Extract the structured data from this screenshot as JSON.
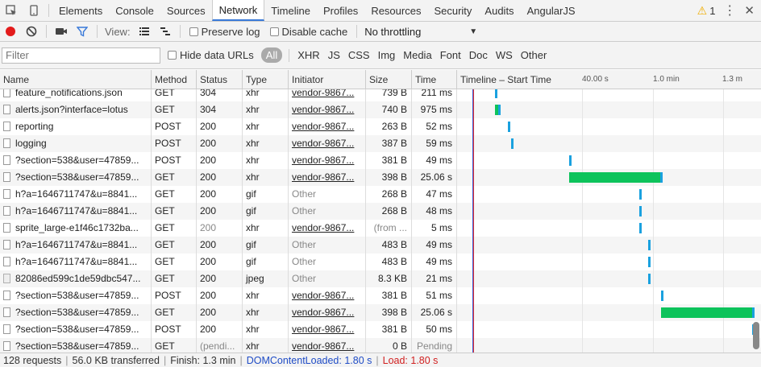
{
  "tabs": [
    "Elements",
    "Console",
    "Sources",
    "Network",
    "Timeline",
    "Profiles",
    "Resources",
    "Security",
    "Audits",
    "AngularJS"
  ],
  "active_tab": "Network",
  "warnings_count": "1",
  "toolbar": {
    "view_label": "View:",
    "preserve_log": "Preserve log",
    "disable_cache": "Disable cache",
    "throttling": "No throttling"
  },
  "filter": {
    "placeholder": "Filter",
    "hide_data_urls": "Hide data URLs",
    "types": [
      "All",
      "XHR",
      "JS",
      "CSS",
      "Img",
      "Media",
      "Font",
      "Doc",
      "WS",
      "Other"
    ]
  },
  "columns": [
    "Name",
    "Method",
    "Status",
    "Type",
    "Initiator",
    "Size",
    "Time",
    "Timeline – Start Time"
  ],
  "timeline_ticks": [
    "40.00 s",
    "1.0 min",
    "1.3 m"
  ],
  "rows": [
    {
      "name": "feature_notifications.json",
      "method": "GET",
      "status": "304",
      "type": "xhr",
      "initiator": "vendor-9867...",
      "size": "739 B",
      "time": "211 ms",
      "icon": "file",
      "bar": {
        "start": 0.125,
        "end": 0.133,
        "kind": "blue"
      }
    },
    {
      "name": "alerts.json?interface=lotus",
      "method": "GET",
      "status": "304",
      "type": "xhr",
      "initiator": "vendor-9867...",
      "size": "740 B",
      "time": "975 ms",
      "icon": "file",
      "bar": {
        "start": 0.125,
        "end": 0.144,
        "kind": "green"
      }
    },
    {
      "name": "reporting",
      "method": "POST",
      "status": "200",
      "type": "xhr",
      "initiator": "vendor-9867...",
      "size": "263 B",
      "time": "52 ms",
      "icon": "file",
      "bar": {
        "start": 0.167,
        "end": 0.175,
        "kind": "blue"
      }
    },
    {
      "name": "logging",
      "method": "POST",
      "status": "200",
      "type": "xhr",
      "initiator": "vendor-9867...",
      "size": "387 B",
      "time": "59 ms",
      "icon": "file",
      "bar": {
        "start": 0.178,
        "end": 0.186,
        "kind": "blue"
      }
    },
    {
      "name": "?section=538&user=47859...",
      "method": "POST",
      "status": "200",
      "type": "xhr",
      "initiator": "vendor-9867...",
      "size": "381 B",
      "time": "49 ms",
      "icon": "file",
      "bar": {
        "start": 0.368,
        "end": 0.376,
        "kind": "blue"
      }
    },
    {
      "name": "?section=538&user=47859...",
      "method": "GET",
      "status": "200",
      "type": "xhr",
      "initiator": "vendor-9867...",
      "size": "398 B",
      "time": "25.06 s",
      "icon": "file",
      "bar": {
        "start": 0.368,
        "end": 0.676,
        "kind": "green"
      }
    },
    {
      "name": "h?a=1646711747&u=8841...",
      "method": "GET",
      "status": "200",
      "type": "gif",
      "initiator": "Other",
      "size": "268 B",
      "time": "47 ms",
      "icon": "file",
      "bar": {
        "start": 0.6,
        "end": 0.608,
        "kind": "blue"
      }
    },
    {
      "name": "h?a=1646711747&u=8841...",
      "method": "GET",
      "status": "200",
      "type": "gif",
      "initiator": "Other",
      "size": "268 B",
      "time": "48 ms",
      "icon": "file",
      "bar": {
        "start": 0.6,
        "end": 0.608,
        "kind": "blue"
      }
    },
    {
      "name": "sprite_large-e1f46c1732ba...",
      "method": "GET",
      "status": "200",
      "type": "xhr",
      "initiator": "vendor-9867...",
      "size": "(from ...",
      "time": "5 ms",
      "icon": "file",
      "dim": true,
      "bar": {
        "start": 0.6,
        "end": 0.608,
        "kind": "blue"
      }
    },
    {
      "name": "h?a=1646711747&u=8841...",
      "method": "GET",
      "status": "200",
      "type": "gif",
      "initiator": "Other",
      "size": "483 B",
      "time": "49 ms",
      "icon": "file",
      "bar": {
        "start": 0.629,
        "end": 0.637,
        "kind": "blue"
      }
    },
    {
      "name": "h?a=1646711747&u=8841...",
      "method": "GET",
      "status": "200",
      "type": "gif",
      "initiator": "Other",
      "size": "483 B",
      "time": "49 ms",
      "icon": "file",
      "bar": {
        "start": 0.629,
        "end": 0.637,
        "kind": "blue"
      }
    },
    {
      "name": "82086ed599c1de59dbc547...",
      "method": "GET",
      "status": "200",
      "type": "jpeg",
      "initiator": "Other",
      "size": "8.3 KB",
      "time": "21 ms",
      "icon": "img",
      "bar": {
        "start": 0.629,
        "end": 0.637,
        "kind": "blue"
      }
    },
    {
      "name": "?section=538&user=47859...",
      "method": "POST",
      "status": "200",
      "type": "xhr",
      "initiator": "vendor-9867...",
      "size": "381 B",
      "time": "51 ms",
      "icon": "file",
      "bar": {
        "start": 0.671,
        "end": 0.679,
        "kind": "blue"
      }
    },
    {
      "name": "?section=538&user=47859...",
      "method": "GET",
      "status": "200",
      "type": "xhr",
      "initiator": "vendor-9867...",
      "size": "398 B",
      "time": "25.06 s",
      "icon": "file",
      "bar": {
        "start": 0.671,
        "end": 0.979,
        "kind": "green"
      }
    },
    {
      "name": "?section=538&user=47859...",
      "method": "POST",
      "status": "200",
      "type": "xhr",
      "initiator": "vendor-9867...",
      "size": "381 B",
      "time": "50 ms",
      "icon": "file",
      "bar": {
        "start": 0.971,
        "end": 0.979,
        "kind": "blue"
      }
    },
    {
      "name": "?section=538&user=47859...",
      "method": "GET",
      "status": "(pendi...",
      "type": "xhr",
      "initiator": "vendor-9867...",
      "size": "0 B",
      "time": "Pending",
      "icon": "file",
      "dim_status": true,
      "bar": null
    }
  ],
  "status": {
    "requests": "128 requests",
    "transferred": "56.0 KB transferred",
    "finish": "Finish: 1.3 min",
    "dcl": "DOMContentLoaded: 1.80 s",
    "load": "Load: 1.80 s"
  },
  "colors": {
    "blue_bar": "#1aa1df",
    "green_bar": "#0dc35b",
    "dcl_line": "#3b5cd8",
    "load_line": "#e03030",
    "accent": "#3879d9"
  }
}
